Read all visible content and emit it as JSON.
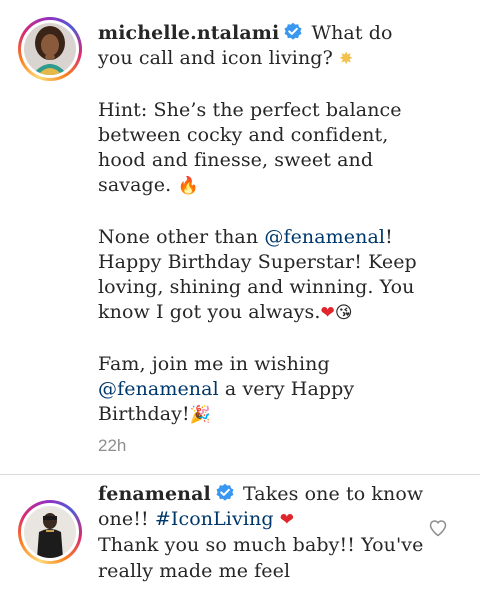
{
  "caption": {
    "username": "michelle.ntalami",
    "verified_icon": "verified-badge-icon",
    "line_first": "What do you call and icon living?",
    "emoji_sparkle": "✸",
    "hint_text": "Hint: She’s the perfect balance between cocky and confident, hood and finesse, sweet and savage.",
    "emoji_fire": "🔥",
    "para2_before": "None other than ",
    "para2_mention": "@fenamenal",
    "para2_after": "! Happy Birthday Superstar! Keep loving, shining and winning. You know I got you always.",
    "emoji_heart": "❤",
    "emoji_kiss": "😘",
    "para3_before": "Fam, join me in wishing ",
    "para3_mention": "@fenamenal",
    "para3_after": " a very Happy Birthday!",
    "emoji_party": "🎉",
    "timestamp": "22h"
  },
  "comment": {
    "username": "fenamenal",
    "verified_icon": "verified-badge-icon",
    "text_before": "Takes one to know one!! ",
    "hashtag": "#IconLiving",
    "emoji_heart": "❤",
    "text_after": "Thank you so much baby!! You've really made me feel",
    "like_icon": "heart-outline-icon"
  },
  "colors": {
    "link": "#00376b",
    "verified": "#3897f0",
    "timestamp": "#8e8e8e",
    "heart": "#e0262c"
  }
}
